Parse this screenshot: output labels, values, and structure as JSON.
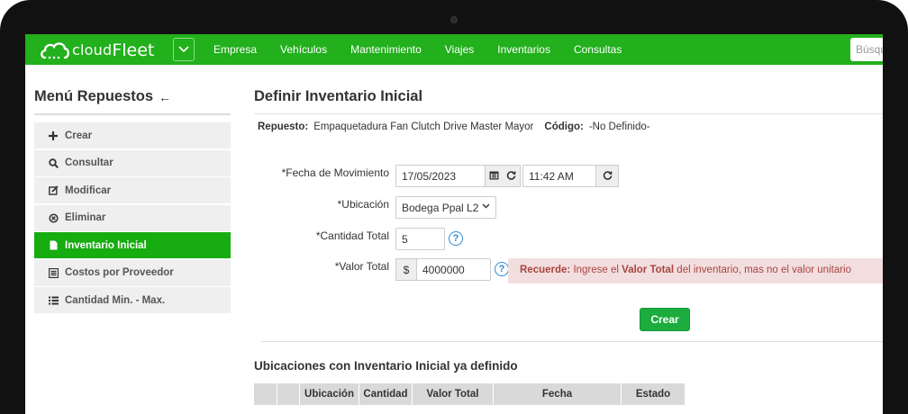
{
  "brand": {
    "logo_text_1": "cloud",
    "logo_text_2": "Fleet"
  },
  "colors": {
    "brand_green": "#22b01c",
    "active_green": "#17ac10",
    "button_green": "#1cad3e",
    "alert_bg": "#f2dede",
    "alert_text": "#a94442",
    "help_blue": "#2e8bd8"
  },
  "nav": {
    "items": [
      "Empresa",
      "Vehículos",
      "Mantenimiento",
      "Viajes",
      "Inventarios",
      "Consultas"
    ],
    "search_placeholder": "Búsqueda"
  },
  "sidebar": {
    "title": "Menú Repuestos",
    "items": [
      {
        "label": "Crear",
        "icon": "plus-icon",
        "active": false
      },
      {
        "label": "Consultar",
        "icon": "search-icon",
        "active": false
      },
      {
        "label": "Modificar",
        "icon": "edit-icon",
        "active": false
      },
      {
        "label": "Eliminar",
        "icon": "remove-circle-icon",
        "active": false
      },
      {
        "label": "Inventario Inicial",
        "icon": "file-icon",
        "active": true
      },
      {
        "label": "Costos por Proveedor",
        "icon": "list-alt-icon",
        "active": false
      },
      {
        "label": "Cantidad Min. - Max.",
        "icon": "list-icon",
        "active": false
      }
    ]
  },
  "main": {
    "title": "Definir Inventario Inicial",
    "part": {
      "label": "Repuesto:",
      "value": "Empaquetadura Fan Clutch Drive Master Mayor",
      "code_label": "Código:",
      "code_value": "-No Definido-"
    },
    "form": {
      "date_label": "*Fecha de Movimiento",
      "date_value": "17/05/2023",
      "time_value": "11:42 AM",
      "location_label": "*Ubicación",
      "location_value": "Bodega Ppal L2",
      "quantity_label": "*Cantidad Total",
      "quantity_value": "5",
      "value_label": "*Valor Total",
      "currency": "$",
      "value_value": "4000000",
      "help": "?"
    },
    "alert": {
      "strong1": "Recuerde:",
      "text1": " Ingrese el ",
      "strong2": "Valor Total",
      "text2": " del inventario, mas no el valor unitario"
    },
    "create_button": "Crear",
    "table": {
      "title": "Ubicaciones con Inventario Inicial ya definido",
      "columns": [
        "",
        "",
        "Ubicación",
        "Cantidad",
        "Valor Total",
        "Fecha",
        "Estado"
      ]
    }
  }
}
